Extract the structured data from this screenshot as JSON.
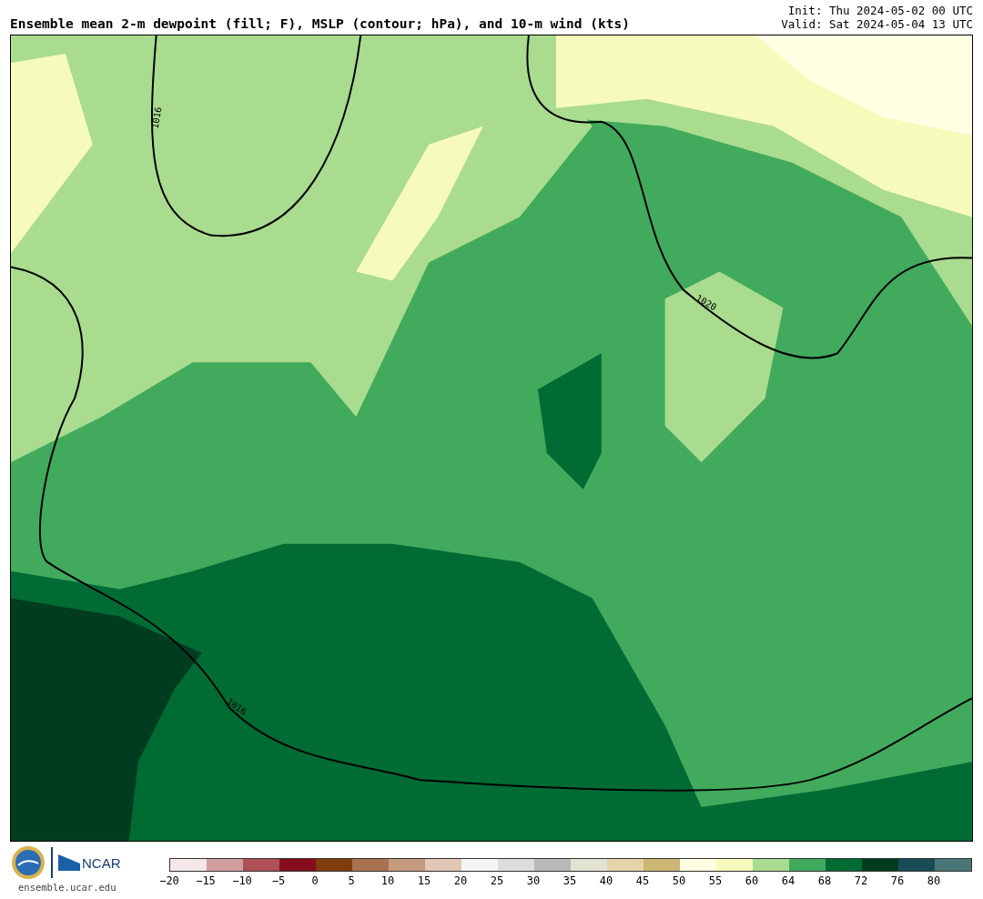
{
  "title": "Ensemble mean 2-m dewpoint (fill; F), MSLP (contour; hPa), and 10-m wind (kts)",
  "run_info": [
    "Init: Thu 2024-05-02 00 UTC",
    "Valid: Sat 2024-05-04 13 UTC"
  ],
  "map": {
    "contour_labels": [
      "1016",
      "1020",
      "1016"
    ]
  },
  "logos": {
    "ncar_text": "NCAR",
    "site": "ensemble.ucar.edu"
  },
  "colorbar": {
    "swatches": [
      {
        "color": "#f4e8e8"
      },
      {
        "color": "#d19ea0"
      },
      {
        "color": "#ad5156"
      },
      {
        "color": "#870d1e"
      },
      {
        "color": "#7f3c0f"
      },
      {
        "color": "#a87250"
      },
      {
        "color": "#c49b7e"
      },
      {
        "color": "#e2c6b6"
      },
      {
        "color": "#f4f4f4"
      },
      {
        "color": "#dddddd"
      },
      {
        "color": "#b9b9b9"
      },
      {
        "color": "#e3e3d3"
      },
      {
        "color": "#e5d4aa"
      },
      {
        "color": "#cdb574"
      },
      {
        "color": "#ffffe3"
      },
      {
        "color": "#f6fbbb"
      },
      {
        "color": "#a9dc8e"
      },
      {
        "color": "#41aa5d"
      },
      {
        "color": "#016b34"
      },
      {
        "color": "#003d20"
      },
      {
        "color": "#174c54"
      },
      {
        "color": "#4a7677"
      }
    ],
    "ticks": [
      "−20",
      "−15",
      "−10",
      "−5",
      "0",
      "5",
      "10",
      "15",
      "20",
      "25",
      "30",
      "35",
      "40",
      "45",
      "50",
      "55",
      "60",
      "64",
      "68",
      "72",
      "76",
      "80"
    ]
  }
}
